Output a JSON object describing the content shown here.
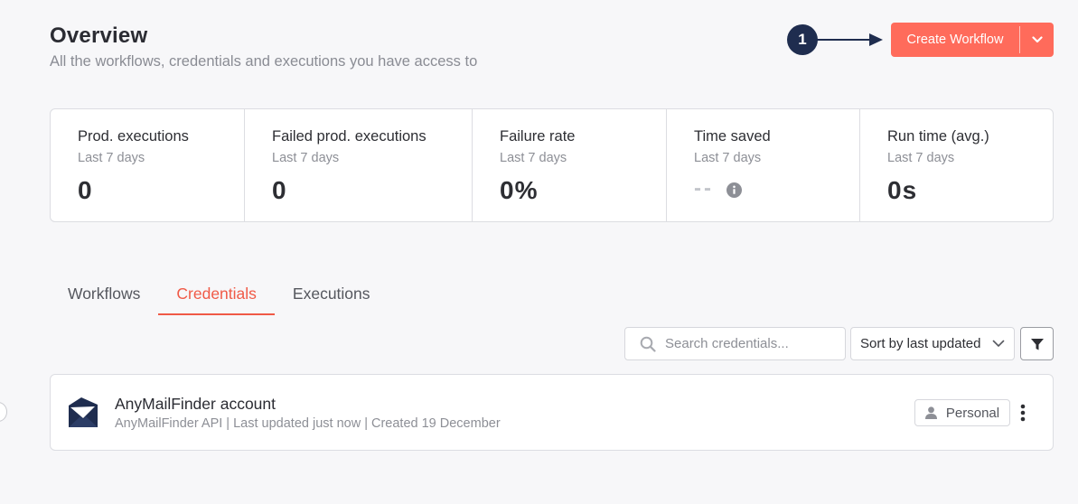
{
  "header": {
    "title": "Overview",
    "subtitle": "All the workflows, credentials and executions you have access to"
  },
  "annotation": {
    "step": "1"
  },
  "create": {
    "label": "Create Workflow",
    "dropdown_icon": "chevron-down-icon",
    "color": "#ff6b5b"
  },
  "stats": [
    {
      "label": "Prod. executions",
      "period": "Last 7 days",
      "value": "0"
    },
    {
      "label": "Failed prod. executions",
      "period": "Last 7 days",
      "value": "0"
    },
    {
      "label": "Failure rate",
      "period": "Last 7 days",
      "value": "0%"
    },
    {
      "label": "Time saved",
      "period": "Last 7 days",
      "value": "--",
      "icon": "info-icon"
    },
    {
      "label": "Run time (avg.)",
      "period": "Last 7 days",
      "value": "0s"
    }
  ],
  "tabs": [
    {
      "label": "Workflows",
      "active": false
    },
    {
      "label": "Credentials",
      "active": true
    },
    {
      "label": "Executions",
      "active": false
    }
  ],
  "search": {
    "placeholder": "Search credentials...",
    "value": "",
    "icon": "search-icon"
  },
  "sort": {
    "selected": "Sort by last updated",
    "icon": "chevron-down-icon"
  },
  "filter": {
    "icon": "filter-icon"
  },
  "credentials": [
    {
      "name": "AnyMailFinder account",
      "meta": "AnyMailFinder API | Last updated just now | Created 19 December",
      "icon": "envelope-icon",
      "owner": "Personal",
      "owner_icon": "user-icon",
      "menu_icon": "more-vertical-icon"
    }
  ],
  "colors": {
    "accent": "#f05a47",
    "badge": "#1f2d4f"
  }
}
